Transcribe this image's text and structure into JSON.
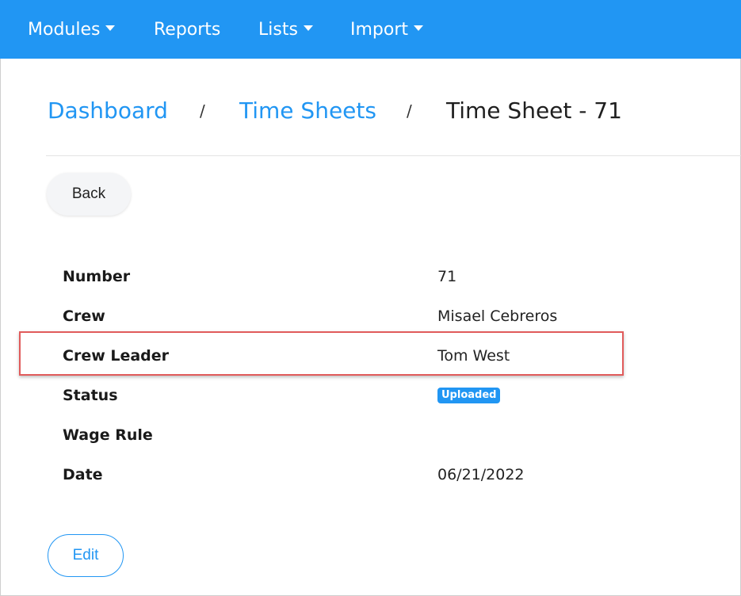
{
  "nav": {
    "modules": "Modules",
    "reports": "Reports",
    "lists": "Lists",
    "import": "Import"
  },
  "breadcrumb": {
    "dashboard": "Dashboard",
    "separator": "/",
    "time_sheets": "Time Sheets",
    "current": "Time Sheet - 71"
  },
  "actions": {
    "back": "Back",
    "edit": "Edit"
  },
  "fields": {
    "number": {
      "label": "Number",
      "value": "71"
    },
    "crew": {
      "label": "Crew",
      "value": "Misael Cebreros"
    },
    "crew_leader": {
      "label": "Crew Leader",
      "value": "Tom West"
    },
    "status": {
      "label": "Status",
      "value": "Uploaded"
    },
    "wage_rule": {
      "label": "Wage Rule",
      "value": ""
    },
    "date": {
      "label": "Date",
      "value": "06/21/2022"
    }
  },
  "colors": {
    "primary": "#2196f3",
    "highlight": "#e15b5b"
  }
}
